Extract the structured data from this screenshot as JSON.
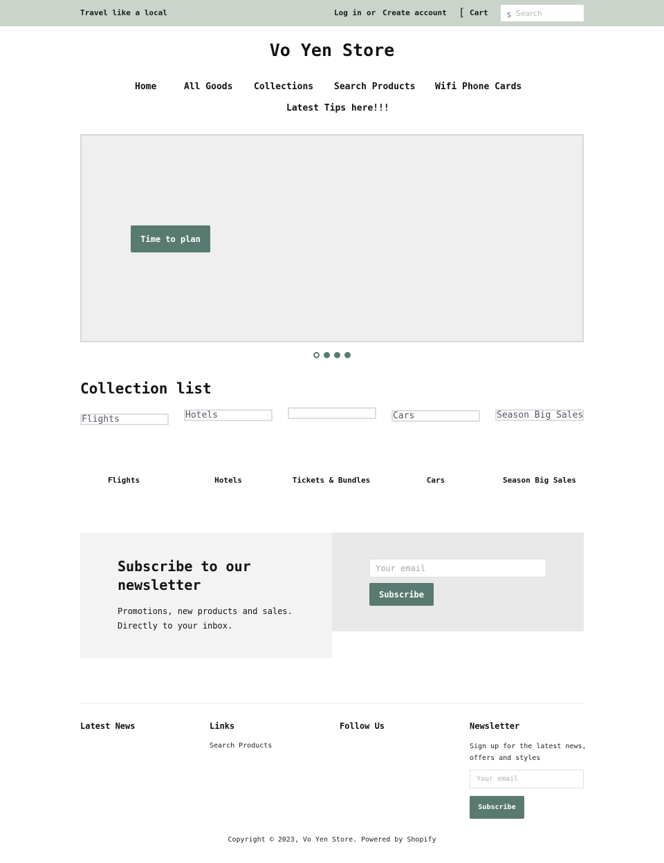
{
  "topbar": {
    "tagline": "Travel like a local",
    "login": "Log in",
    "or": "or",
    "create_account": "Create account",
    "cart_icon": "[",
    "cart": "Cart",
    "search_icon": "S",
    "search_placeholder": "Search"
  },
  "store": {
    "title": "Vo Yen Store"
  },
  "nav": {
    "items": [
      {
        "label": "Home"
      },
      {
        "label": "All Goods"
      },
      {
        "label": "Collections"
      },
      {
        "label": "Search Products"
      },
      {
        "label": "Wifi Phone Cards"
      },
      {
        "label": "Latest Tips here!!!"
      }
    ]
  },
  "slideshow": {
    "button_label": "Time to plan",
    "slide_count": 4,
    "active_slide": 1
  },
  "collections": {
    "heading": "Collection list",
    "image_alts": [
      "Flights",
      "Hotels",
      "",
      "Cars",
      "Season Big Sales"
    ],
    "items": [
      {
        "label": "Flights"
      },
      {
        "label": "Hotels"
      },
      {
        "label": "Tickets & Bundles"
      },
      {
        "label": "Cars"
      },
      {
        "label": "Season Big Sales"
      }
    ]
  },
  "newsletter": {
    "heading": "Subscribe to our newsletter",
    "body": "Promotions, new products and sales. Directly to your inbox.",
    "email_placeholder": "Your email",
    "button_label": "Subscribe"
  },
  "footer": {
    "latest_news": "Latest News",
    "links_heading": "Links",
    "links": [
      {
        "label": "Search Products"
      }
    ],
    "follow_us": "Follow Us",
    "newsletter_heading": "Newsletter",
    "newsletter_desc": "Sign up for the latest news, offers and styles",
    "email_placeholder": "Your email",
    "button_label": "Subscribe",
    "copyright": "Copyright © 2023, Vo Yen Store. Powered by Shopify"
  },
  "colors": {
    "topbar_bg": "#cbd4cb",
    "accent": "#587a70"
  }
}
